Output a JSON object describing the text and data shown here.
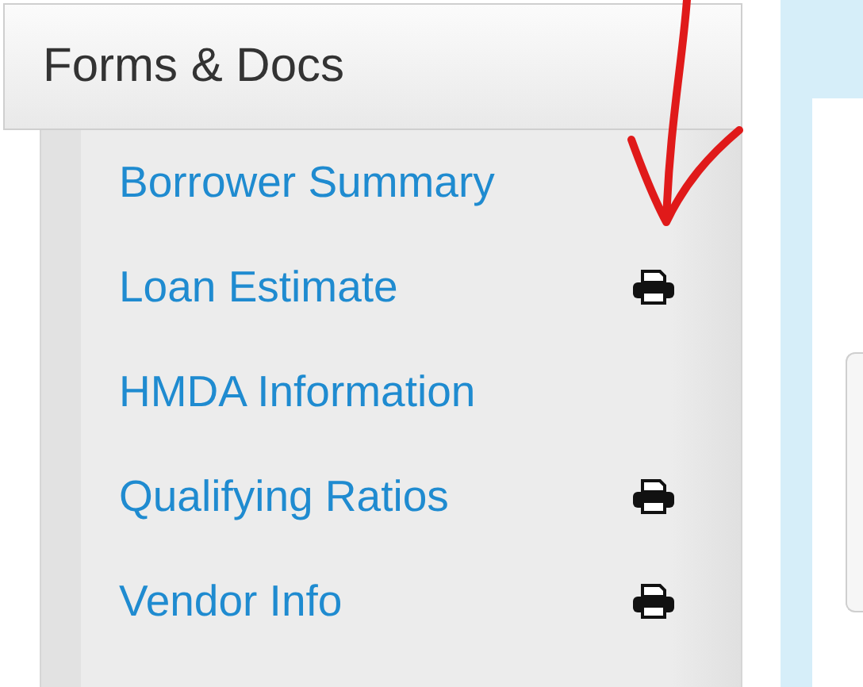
{
  "panel": {
    "title": "Forms & Docs"
  },
  "items": [
    {
      "label": "Borrower Summary",
      "printable": false
    },
    {
      "label": "Loan Estimate",
      "printable": true
    },
    {
      "label": "HMDA Information",
      "printable": false
    },
    {
      "label": "Qualifying Ratios",
      "printable": true
    },
    {
      "label": "Vendor Info",
      "printable": true
    }
  ]
}
